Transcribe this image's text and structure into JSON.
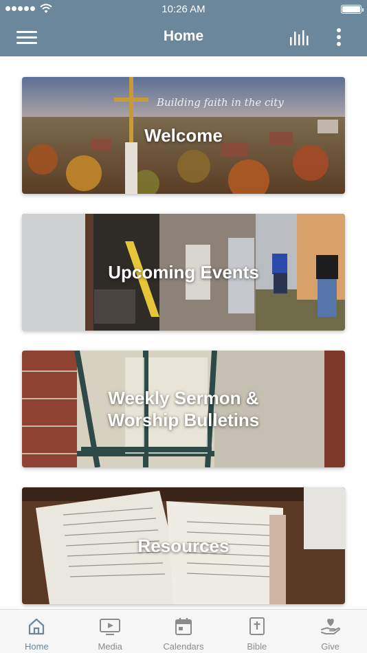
{
  "status_bar": {
    "time": "10:26 AM"
  },
  "nav": {
    "title": "Home"
  },
  "cards": [
    {
      "title": "Welcome",
      "tagline": "Building faith in the city"
    },
    {
      "title": "Upcoming Events"
    },
    {
      "title_line1": "Weekly Sermon &",
      "title_line2": "Worship Bulletins"
    },
    {
      "title": "Resources"
    }
  ],
  "tabs": [
    {
      "label": "Home",
      "icon": "home-icon",
      "active": true
    },
    {
      "label": "Media",
      "icon": "media-icon"
    },
    {
      "label": "Calendars",
      "icon": "calendar-icon"
    },
    {
      "label": "Bible",
      "icon": "bible-icon"
    },
    {
      "label": "Give",
      "icon": "give-icon"
    }
  ],
  "colors": {
    "header": "#6a879c",
    "active_tab": "#6a879c",
    "inactive_tab": "#8c8c8c"
  }
}
